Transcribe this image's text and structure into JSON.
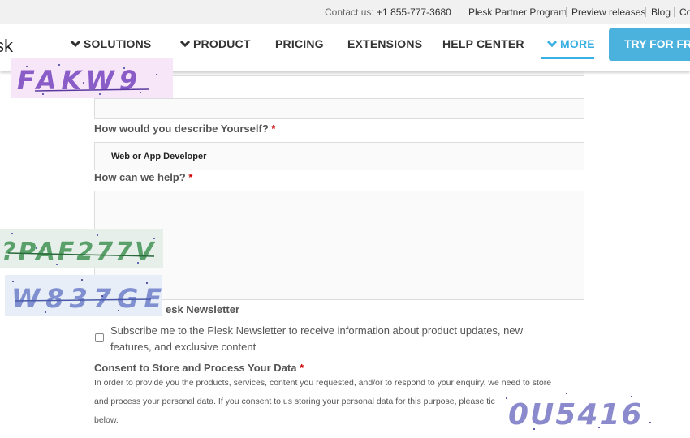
{
  "topbar": {
    "contact_label": "Contact us:",
    "phone": "+1 855-777-3680",
    "links": [
      "Plesk Partner Program",
      "Preview releases",
      "Blog",
      "Co"
    ]
  },
  "nav": {
    "logo": "sk",
    "items": [
      "SOLUTIONS",
      "PRODUCT",
      "PRICING",
      "EXTENSIONS",
      "HELP CENTER",
      "MORE"
    ],
    "cta": "TRY FOR FRE",
    "accent_color": "#3ab0e2"
  },
  "form": {
    "describe_label": "How would you describe Yourself?",
    "describe_value": "Web or App Developer",
    "help_label": "How can we help?",
    "newsletter_label": "esk Newsletter",
    "newsletter_text": "Subscribe me to the Plesk Newsletter to receive information about product updates, new features, and exclusive content",
    "consent_label": "Consent to Store and Process Your Data",
    "consent_line1": "In order to provide you the products, services, content you requested, and/or to respond to your enquiry, we need to store",
    "consent_line2": "and process your personal data. If you consent to us storing your personal data for this purpose, please tic",
    "consent_line3": "below.",
    "required_mark": "*"
  },
  "captchas": {
    "c1": "FAKW9",
    "c2": "?PAF277V",
    "c3": "W837GE",
    "c4": "0U5416"
  }
}
